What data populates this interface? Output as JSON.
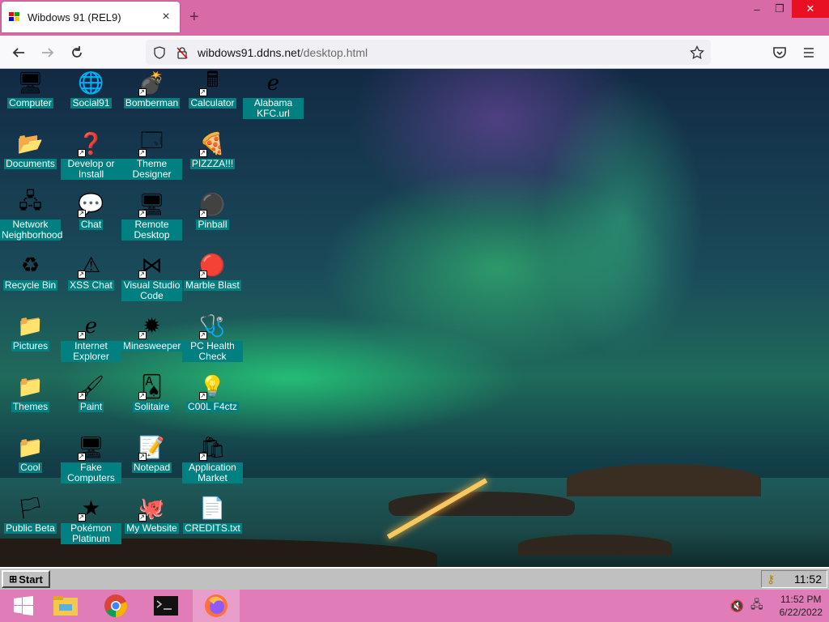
{
  "browser": {
    "tab_title": "Wibdows 91 (REL9)",
    "tab_close": "×",
    "new_tab": "+",
    "url_host": "wibdows91.ddns.net",
    "url_path": "/desktop.html",
    "window_controls": {
      "minimize": "–",
      "restore": "❐",
      "close": "✕"
    }
  },
  "desktop": {
    "icons": [
      {
        "label": "Computer",
        "icon": "computer-icon",
        "glyph": "🖥"
      },
      {
        "label": "Documents",
        "icon": "documents-folder-icon",
        "glyph": "📂"
      },
      {
        "label": "Network Neighborhood",
        "icon": "network-icon",
        "glyph": "🖧"
      },
      {
        "label": "Recycle Bin",
        "icon": "recycle-bin-icon",
        "glyph": "♻"
      },
      {
        "label": "Pictures",
        "icon": "folder-icon",
        "glyph": "📁"
      },
      {
        "label": "Themes",
        "icon": "folder-icon",
        "glyph": "📁"
      },
      {
        "label": "Cool",
        "icon": "folder-icon",
        "glyph": "📁"
      },
      {
        "label": "Public Beta",
        "icon": "windows-flag-icon",
        "glyph": "🏳"
      },
      {
        "label": "Social91",
        "icon": "globe-icon",
        "glyph": "🌐"
      },
      {
        "label": "Develop or Install",
        "icon": "setup-icon",
        "glyph": "❓"
      },
      {
        "label": "Chat",
        "icon": "chat-bubble-icon",
        "glyph": "💬"
      },
      {
        "label": "XSS Chat",
        "icon": "warning-chat-icon",
        "glyph": "⚠"
      },
      {
        "label": "Internet Explorer",
        "icon": "internet-explorer-icon",
        "glyph": "ℯ"
      },
      {
        "label": "Paint",
        "icon": "paint-icon",
        "glyph": "🖌"
      },
      {
        "label": "Fake Computers",
        "icon": "computer-icon",
        "glyph": "🖥"
      },
      {
        "label": "Pokémon Platinum",
        "icon": "pokemon-icon",
        "glyph": "★"
      },
      {
        "label": "Bomberman",
        "icon": "bomberman-icon",
        "glyph": "💣"
      },
      {
        "label": "Theme Designer",
        "icon": "window-icon",
        "glyph": "🗔"
      },
      {
        "label": "Remote Desktop",
        "icon": "remote-desktop-icon",
        "glyph": "🖥"
      },
      {
        "label": "Visual Studio Code",
        "icon": "vscode-icon",
        "glyph": "⋈"
      },
      {
        "label": "Minesweeper",
        "icon": "mine-icon",
        "glyph": "✹"
      },
      {
        "label": "Solitaire",
        "icon": "cards-icon",
        "glyph": "🂡"
      },
      {
        "label": "Notepad",
        "icon": "notepad-icon",
        "glyph": "📝"
      },
      {
        "label": "My Website",
        "icon": "github-icon",
        "glyph": "🐙"
      },
      {
        "label": "Calculator",
        "icon": "calculator-icon",
        "glyph": "🖩"
      },
      {
        "label": "PIZZZA!!!",
        "icon": "pizza-icon",
        "glyph": "🍕"
      },
      {
        "label": "Pinball",
        "icon": "pinball-icon",
        "glyph": "⚫"
      },
      {
        "label": "Marble Blast",
        "icon": "marble-icon",
        "glyph": "🔴"
      },
      {
        "label": "PC Health Check",
        "icon": "health-check-icon",
        "glyph": "🩺"
      },
      {
        "label": "C00L F4ctz",
        "icon": "lightbulb-icon",
        "glyph": "💡"
      },
      {
        "label": "Application Market",
        "icon": "market-icon",
        "glyph": "🛍"
      },
      {
        "label": "CREDITS.txt",
        "icon": "text-file-icon",
        "glyph": "📄"
      },
      {
        "label": "Alabama KFC.url",
        "icon": "url-file-icon",
        "glyph": "ℯ"
      }
    ]
  },
  "win91_taskbar": {
    "start_label": "Start",
    "clock": "11:52"
  },
  "windows_taskbar": {
    "time": "11:52 PM",
    "date": "6/22/2022"
  },
  "colors": {
    "tabbar": "#d86aa8",
    "taskbar": "#e07cb8",
    "icon_label_bg": "#008080"
  }
}
